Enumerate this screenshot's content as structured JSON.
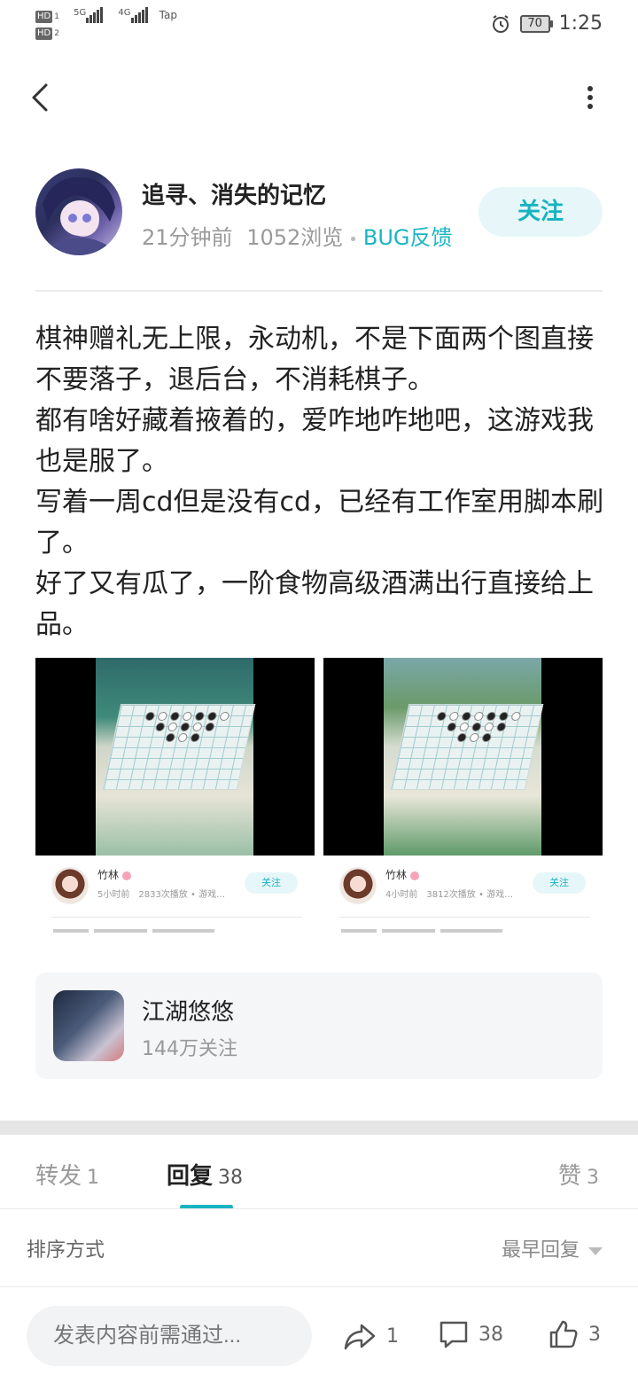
{
  "status_bar": {
    "hd1": "HD",
    "hd1_sub": "1",
    "hd2": "HD",
    "hd2_sub": "2",
    "net1": "5G",
    "net2": "4G",
    "extra": "Tap",
    "battery": "70",
    "time": "1:25"
  },
  "author": {
    "name": "追寻、消失的记忆",
    "time_ago": "21分钟前",
    "views": "1052浏览",
    "category": "BUG反馈",
    "follow_label": "关注"
  },
  "post": {
    "paragraphs": [
      "棋神赠礼无上限，永动机，不是下面两个图直接不要落子，退后台，不消耗棋子。",
      "都有啥好藏着掖着的，爱咋地咋地吧，这游戏我也是服了。",
      "写着一周cd但是没有cd，已经有工作室用脚本刷了。",
      "好了又有瓜了，一阶食物高级酒满出行直接给上品。"
    ]
  },
  "images": [
    {
      "author": "竹林",
      "meta": "5小时前　2833次播放 • 游戏…",
      "follow": "关注"
    },
    {
      "author": "竹林",
      "meta": "4小时前　3812次播放 • 游戏…",
      "follow": "关注"
    }
  ],
  "game_card": {
    "name": "江湖悠悠",
    "followers": "144万关注"
  },
  "tabs": {
    "repost_label": "转发",
    "repost_count": "1",
    "reply_label": "回复",
    "reply_count": "38",
    "like_label": "赞",
    "like_count": "3"
  },
  "sort": {
    "label": "排序方式",
    "value": "最早回复"
  },
  "bottom_bar": {
    "input_placeholder": "发表内容前需通过...",
    "share_count": "1",
    "comment_count": "38",
    "like_count": "3"
  },
  "colors": {
    "accent": "#19b5c3",
    "follow_bg": "#e7f7f9"
  }
}
